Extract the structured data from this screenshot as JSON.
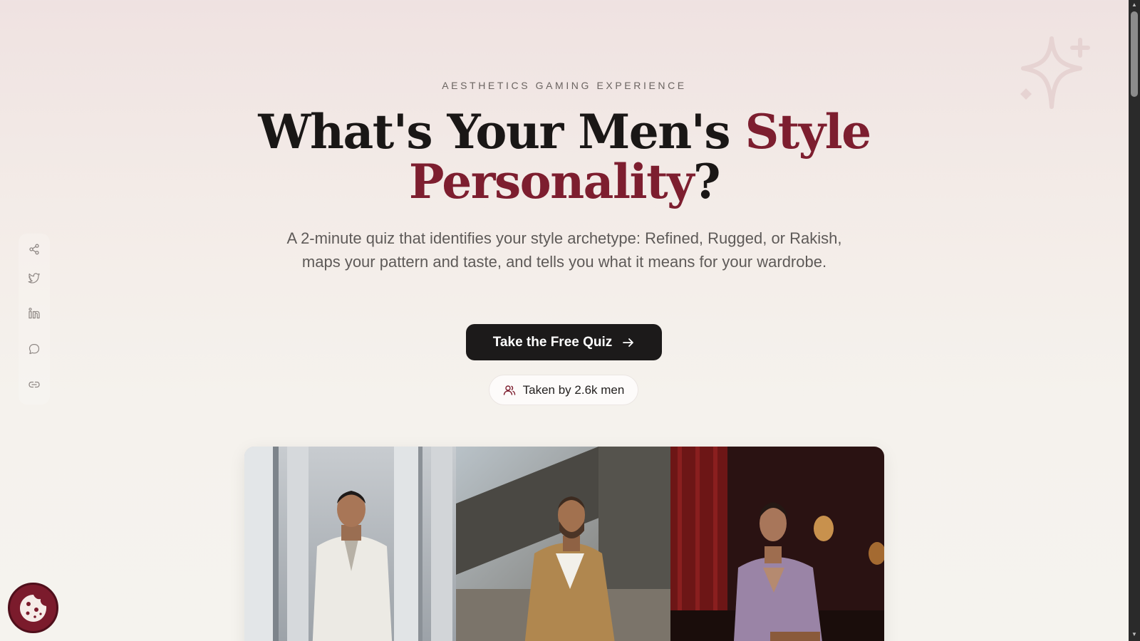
{
  "hero": {
    "eyebrow": "AESTHETICS GAMING EXPERIENCE",
    "headline_part1": "What's Your Men's ",
    "headline_accent1": "Style",
    "headline_accent2": "Personality",
    "headline_end": "?",
    "subhead": "A 2-minute quiz that identifies your style archetype: Refined, Rugged, or Rakish, maps your pattern and taste, and tells you what it means for your wardrobe.",
    "cta_label": "Take the Free Quiz",
    "taken_label": "Taken by 2.6k men"
  },
  "share_rail": {
    "items": [
      {
        "icon": "share-icon"
      },
      {
        "icon": "twitter-icon"
      },
      {
        "icon": "linkedin-icon"
      },
      {
        "icon": "comment-icon"
      },
      {
        "icon": "link-icon"
      }
    ]
  },
  "photos": [
    {
      "archetype": "refined"
    },
    {
      "archetype": "rugged"
    },
    {
      "archetype": "rakish"
    }
  ],
  "colors": {
    "accent": "#7d1e2f",
    "cta_bg": "#1c1a1a",
    "cookie_bg": "#7b1b2c"
  }
}
